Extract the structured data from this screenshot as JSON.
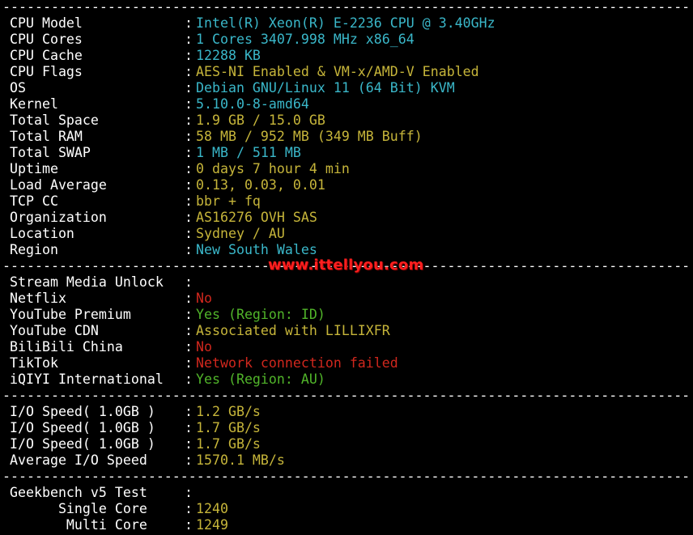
{
  "separator": "---------------------------------------------------------------------------------------",
  "system_info": [
    {
      "label": "CPU Model",
      "value": "Intel(R) Xeon(R) E-2236 CPU @ 3.40GHz",
      "color": "cyan"
    },
    {
      "label": "CPU Cores",
      "value": "1 Cores 3407.998 MHz x86_64",
      "color": "cyan"
    },
    {
      "label": "CPU Cache",
      "value": "12288 KB",
      "color": "cyan"
    },
    {
      "label": "CPU Flags",
      "value": "AES-NI Enabled & VM-x/AMD-V Enabled",
      "color": "yellow"
    },
    {
      "label": "OS",
      "value": "Debian GNU/Linux 11 (64 Bit) KVM",
      "color": "cyan"
    },
    {
      "label": "Kernel",
      "value": "5.10.0-8-amd64",
      "color": "cyan"
    },
    {
      "label": "Total Space",
      "value": "1.9 GB / 15.0 GB",
      "color": "yellow"
    },
    {
      "label": "Total RAM",
      "value": "58 MB / 952 MB (349 MB Buff)",
      "color": "yellow"
    },
    {
      "label": "Total SWAP",
      "value": "1 MB / 511 MB",
      "color": "cyan"
    },
    {
      "label": "Uptime",
      "value": "0 days 7 hour 4 min",
      "color": "yellow"
    },
    {
      "label": "Load Average",
      "value": "0.13, 0.03, 0.01",
      "color": "yellow"
    },
    {
      "label": "TCP CC",
      "value": "bbr + fq",
      "color": "yellow"
    },
    {
      "label": "Organization",
      "value": "AS16276 OVH SAS",
      "color": "yellow"
    },
    {
      "label": "Location",
      "value": "Sydney / AU",
      "color": "yellow"
    },
    {
      "label": "Region",
      "value": "New South Wales",
      "color": "cyan"
    }
  ],
  "stream": {
    "header": "Stream Media Unlock",
    "items": [
      {
        "label": "Netflix",
        "value": "No",
        "color": "red"
      },
      {
        "label": "YouTube Premium",
        "value": "Yes (Region: ID)",
        "color": "green"
      },
      {
        "label": "YouTube CDN",
        "value": "Associated with LILLIXFR",
        "color": "yellow"
      },
      {
        "label": "BiliBili China",
        "value": "No",
        "color": "red"
      },
      {
        "label": "TikTok",
        "value": "Network connection failed",
        "color": "red"
      },
      {
        "label": "iQIYI International",
        "value": "Yes (Region: AU)",
        "color": "green"
      }
    ]
  },
  "watermark": "www.ittellyou.com",
  "io": [
    {
      "label": "I/O Speed( 1.0GB )",
      "value": "1.2 GB/s",
      "color": "yellow"
    },
    {
      "label": "I/O Speed( 1.0GB )",
      "value": "1.7 GB/s",
      "color": "yellow"
    },
    {
      "label": "I/O Speed( 1.0GB )",
      "value": "1.7 GB/s",
      "color": "yellow"
    },
    {
      "label": "Average I/O Speed",
      "value": "1570.1 MB/s",
      "color": "yellow"
    }
  ],
  "geekbench": {
    "header": "Geekbench v5 Test",
    "items": [
      {
        "label": "      Single Core",
        "value": "1240",
        "color": "yellow"
      },
      {
        "label": "       Multi Core",
        "value": "1249",
        "color": "yellow"
      }
    ]
  },
  "colors": {
    "cyan": "#3ab7c9",
    "yellow": "#c6b53a",
    "red": "#d0271d",
    "green": "#51b52a",
    "white": "#ffffff",
    "background": "#000000",
    "watermark": "#ff1f1f"
  }
}
